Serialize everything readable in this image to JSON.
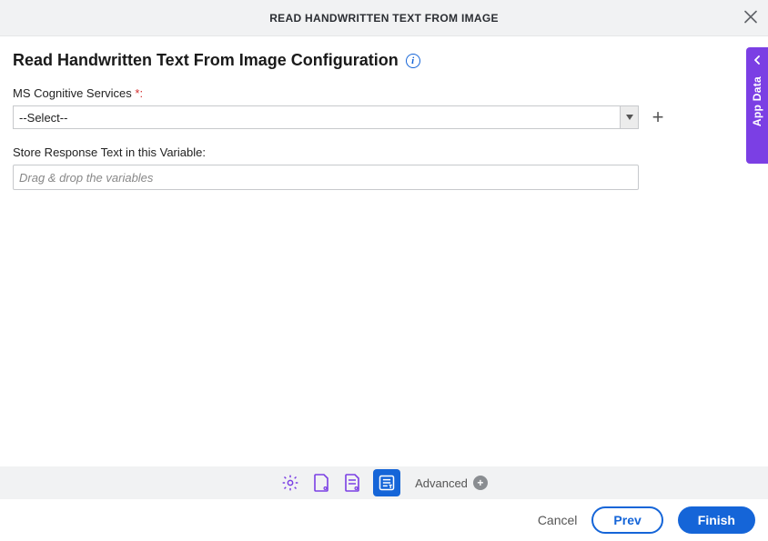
{
  "header": {
    "title": "READ HANDWRITTEN TEXT FROM IMAGE"
  },
  "config": {
    "title": "Read Handwritten Text From Image Configuration"
  },
  "fields": {
    "cognitive_label": "MS Cognitive Services ",
    "required_mark": "*:",
    "cognitive_selected": "--Select--",
    "variable_label": "Store Response Text in this Variable:",
    "variable_placeholder": "Drag & drop the variables"
  },
  "stepbar": {
    "advanced_label": "Advanced"
  },
  "footer": {
    "cancel": "Cancel",
    "prev": "Prev",
    "finish": "Finish"
  },
  "side": {
    "label": "App Data"
  }
}
